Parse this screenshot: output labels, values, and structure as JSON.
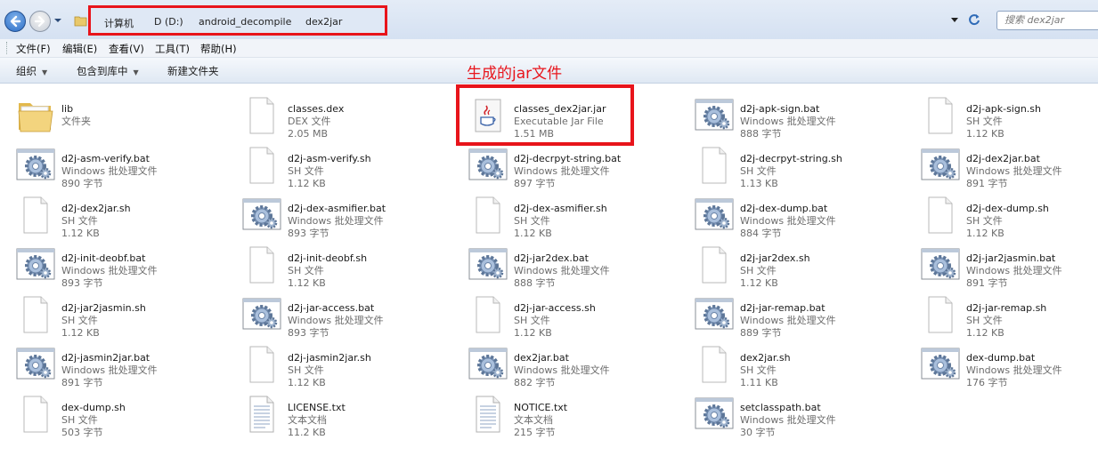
{
  "address": {
    "crumbs": [
      "计算机",
      "D (D:)",
      "android_decompile",
      "dex2jar"
    ],
    "search_placeholder": "搜索 dex2jar"
  },
  "menu": [
    "文件(F)",
    "编辑(E)",
    "查看(V)",
    "工具(T)",
    "帮助(H)"
  ],
  "commands": {
    "organize": "组织",
    "include_library": "包含到库中",
    "new_folder": "新建文件夹"
  },
  "annotation": "生成的jar文件",
  "accent": {
    "highlight": "#e8141b"
  },
  "files": [
    {
      "name": "lib",
      "type": "文件夹",
      "size": "",
      "icon": "folder-icon"
    },
    {
      "name": "classes.dex",
      "type": "DEX 文件",
      "size": "2.05 MB",
      "icon": "document-icon"
    },
    {
      "name": "classes_dex2jar.jar",
      "type": "Executable Jar File",
      "size": "1.51 MB",
      "icon": "java-jar-icon"
    },
    {
      "name": "d2j-apk-sign.bat",
      "type": "Windows 批处理文件",
      "size": "888 字节",
      "icon": "batch-gear-icon"
    },
    {
      "name": "d2j-apk-sign.sh",
      "type": "SH 文件",
      "size": "1.12 KB",
      "icon": "document-icon"
    },
    {
      "name": "d2j-asm-verify.bat",
      "type": "Windows 批处理文件",
      "size": "890 字节",
      "icon": "batch-gear-icon"
    },
    {
      "name": "d2j-asm-verify.sh",
      "type": "SH 文件",
      "size": "1.12 KB",
      "icon": "document-icon"
    },
    {
      "name": "d2j-decrpyt-string.bat",
      "type": "Windows 批处理文件",
      "size": "897 字节",
      "icon": "batch-gear-icon"
    },
    {
      "name": "d2j-decrpyt-string.sh",
      "type": "SH 文件",
      "size": "1.13 KB",
      "icon": "document-icon"
    },
    {
      "name": "d2j-dex2jar.bat",
      "type": "Windows 批处理文件",
      "size": "891 字节",
      "icon": "batch-gear-icon"
    },
    {
      "name": "d2j-dex2jar.sh",
      "type": "SH 文件",
      "size": "1.12 KB",
      "icon": "document-icon"
    },
    {
      "name": "d2j-dex-asmifier.bat",
      "type": "Windows 批处理文件",
      "size": "893 字节",
      "icon": "batch-gear-icon"
    },
    {
      "name": "d2j-dex-asmifier.sh",
      "type": "SH 文件",
      "size": "1.12 KB",
      "icon": "document-icon"
    },
    {
      "name": "d2j-dex-dump.bat",
      "type": "Windows 批处理文件",
      "size": "884 字节",
      "icon": "batch-gear-icon"
    },
    {
      "name": "d2j-dex-dump.sh",
      "type": "SH 文件",
      "size": "1.12 KB",
      "icon": "document-icon"
    },
    {
      "name": "d2j-init-deobf.bat",
      "type": "Windows 批处理文件",
      "size": "893 字节",
      "icon": "batch-gear-icon"
    },
    {
      "name": "d2j-init-deobf.sh",
      "type": "SH 文件",
      "size": "1.12 KB",
      "icon": "document-icon"
    },
    {
      "name": "d2j-jar2dex.bat",
      "type": "Windows 批处理文件",
      "size": "888 字节",
      "icon": "batch-gear-icon"
    },
    {
      "name": "d2j-jar2dex.sh",
      "type": "SH 文件",
      "size": "1.12 KB",
      "icon": "document-icon"
    },
    {
      "name": "d2j-jar2jasmin.bat",
      "type": "Windows 批处理文件",
      "size": "891 字节",
      "icon": "batch-gear-icon"
    },
    {
      "name": "d2j-jar2jasmin.sh",
      "type": "SH 文件",
      "size": "1.12 KB",
      "icon": "document-icon"
    },
    {
      "name": "d2j-jar-access.bat",
      "type": "Windows 批处理文件",
      "size": "893 字节",
      "icon": "batch-gear-icon"
    },
    {
      "name": "d2j-jar-access.sh",
      "type": "SH 文件",
      "size": "1.12 KB",
      "icon": "document-icon"
    },
    {
      "name": "d2j-jar-remap.bat",
      "type": "Windows 批处理文件",
      "size": "889 字节",
      "icon": "batch-gear-icon"
    },
    {
      "name": "d2j-jar-remap.sh",
      "type": "SH 文件",
      "size": "1.12 KB",
      "icon": "document-icon"
    },
    {
      "name": "d2j-jasmin2jar.bat",
      "type": "Windows 批处理文件",
      "size": "891 字节",
      "icon": "batch-gear-icon"
    },
    {
      "name": "d2j-jasmin2jar.sh",
      "type": "SH 文件",
      "size": "1.12 KB",
      "icon": "document-icon"
    },
    {
      "name": "dex2jar.bat",
      "type": "Windows 批处理文件",
      "size": "882 字节",
      "icon": "batch-gear-icon"
    },
    {
      "name": "dex2jar.sh",
      "type": "SH 文件",
      "size": "1.11 KB",
      "icon": "document-icon"
    },
    {
      "name": "dex-dump.bat",
      "type": "Windows 批处理文件",
      "size": "176 字节",
      "icon": "batch-gear-icon"
    },
    {
      "name": "dex-dump.sh",
      "type": "SH 文件",
      "size": "503 字节",
      "icon": "document-icon"
    },
    {
      "name": "LICENSE.txt",
      "type": "文本文档",
      "size": "11.2 KB",
      "icon": "text-document-icon"
    },
    {
      "name": "NOTICE.txt",
      "type": "文本文档",
      "size": "215 字节",
      "icon": "text-document-icon"
    },
    {
      "name": "setclasspath.bat",
      "type": "Windows 批处理文件",
      "size": "30 字节",
      "icon": "batch-gear-icon"
    }
  ]
}
